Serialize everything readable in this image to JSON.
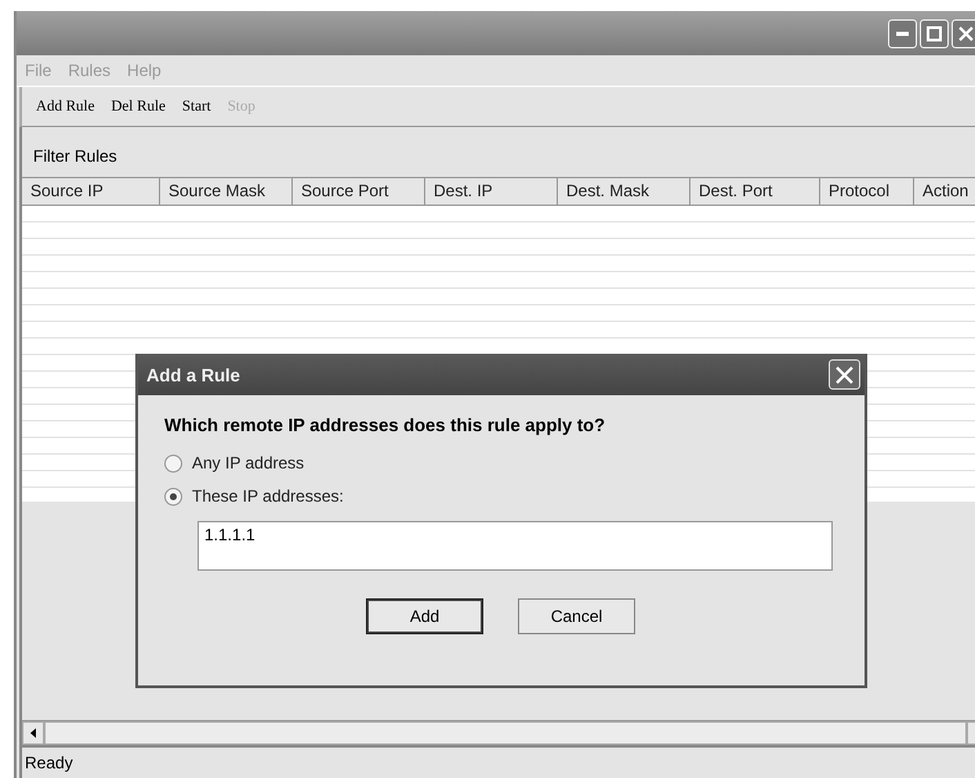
{
  "menu": [
    {
      "label": "File",
      "disabled": true
    },
    {
      "label": "Rules",
      "disabled": true
    },
    {
      "label": "Help",
      "disabled": true
    }
  ],
  "toolbar": [
    {
      "label": "Add Rule",
      "disabled": false
    },
    {
      "label": "Del Rule",
      "disabled": false
    },
    {
      "label": "Start",
      "disabled": false
    },
    {
      "label": "Stop",
      "disabled": true
    }
  ],
  "section_title": "Filter Rules",
  "table": {
    "columns": [
      "Source IP",
      "Source Mask",
      "Source Port",
      "Dest. IP",
      "Dest. Mask",
      "Dest. Port",
      "Protocol",
      "Action"
    ]
  },
  "dialog": {
    "title": "Add a Rule",
    "question": "Which remote IP addresses does this rule apply to?",
    "options": [
      {
        "label": "Any IP address",
        "selected": false
      },
      {
        "label": "These IP addresses:",
        "selected": true
      }
    ],
    "addresses_value": "1.1.1.1",
    "buttons": [
      {
        "label": "Add",
        "kind": "default"
      },
      {
        "label": "Cancel",
        "kind": "normal"
      }
    ]
  },
  "status_bar": "Ready"
}
